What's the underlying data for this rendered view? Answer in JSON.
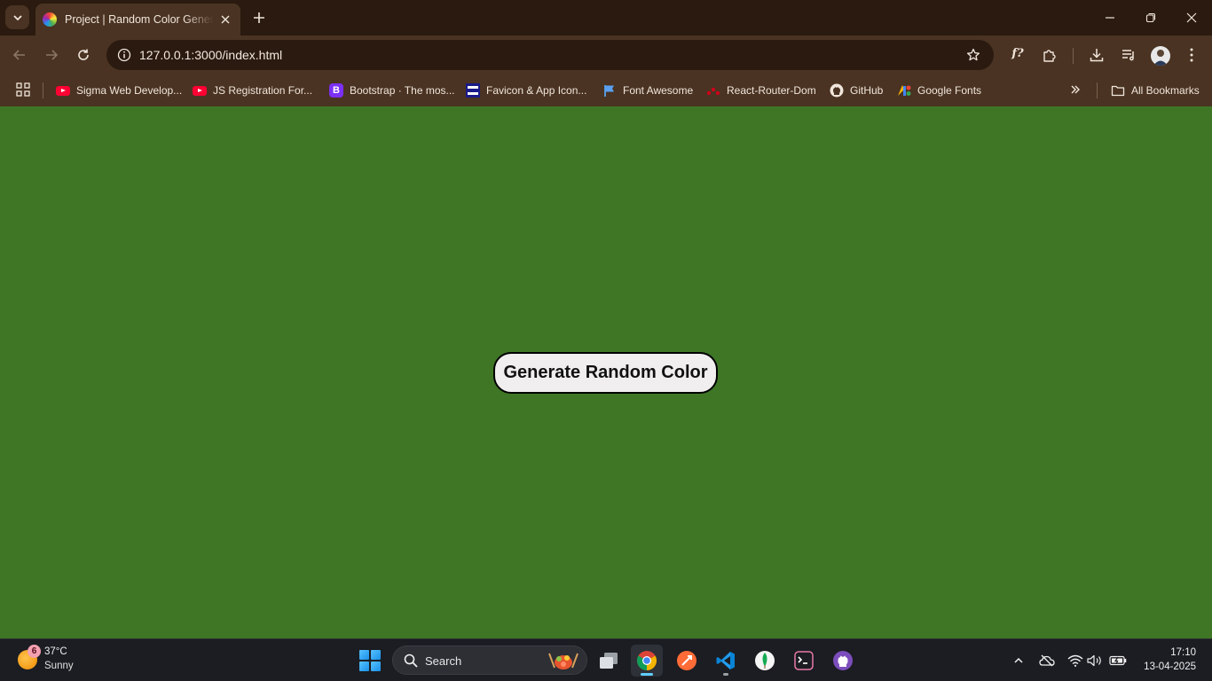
{
  "browser": {
    "tab": {
      "title": "Project | Random Color Generator"
    },
    "address": {
      "url": "127.0.0.1:3000/index.html"
    },
    "bookmarks": [
      {
        "label": "Sigma Web Develop...",
        "icon": "youtube-icon"
      },
      {
        "label": "JS Registration For...",
        "icon": "youtube-icon"
      },
      {
        "label": "Bootstrap · The mos...",
        "icon": "bootstrap-icon"
      },
      {
        "label": "Favicon & App Icon...",
        "icon": "favicon-icon"
      },
      {
        "label": "Font Awesome",
        "icon": "font-awesome-icon"
      },
      {
        "label": "React-Router-Dom",
        "icon": "react-router-icon"
      },
      {
        "label": "GitHub",
        "icon": "github-icon"
      },
      {
        "label": "Google Fonts",
        "icon": "google-fonts-icon"
      }
    ],
    "all_bookmarks_label": "All Bookmarks"
  },
  "page": {
    "background_color": "#3e7626",
    "button_label": "Generate Random Color"
  },
  "taskbar": {
    "weather": {
      "badge": "6",
      "temp": "37°C",
      "desc": "Sunny"
    },
    "search_label": "Search",
    "clock": {
      "time": "17:10",
      "date": "13-04-2025"
    }
  }
}
